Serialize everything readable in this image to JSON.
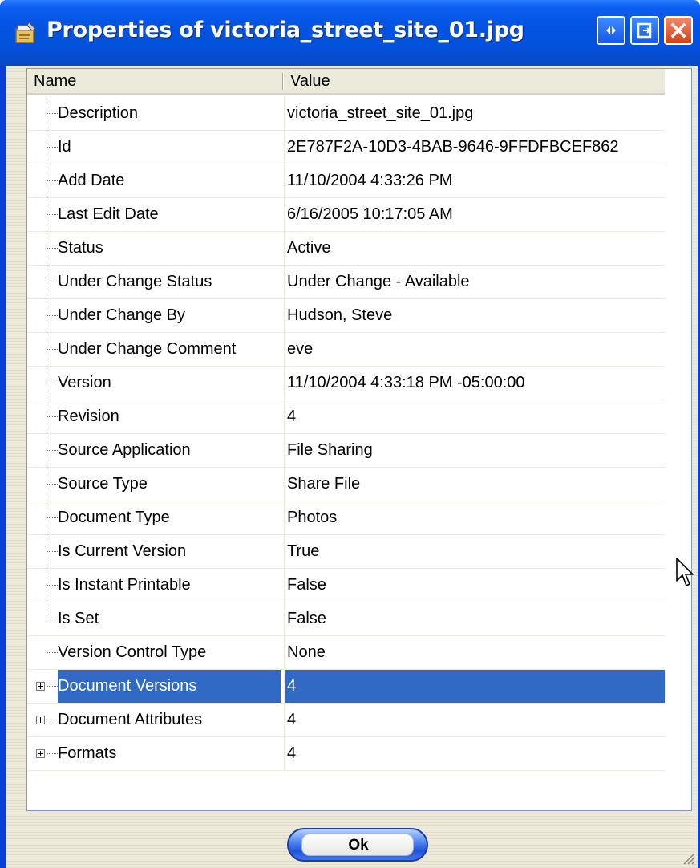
{
  "window": {
    "title": "Properties of victoria_street_site_01.jpg",
    "icons": {
      "app": "properties-icon",
      "restore": "restore-arrows-icon",
      "maximize": "maximize-icon",
      "close": "close-icon"
    }
  },
  "grid": {
    "columns": {
      "name": "Name",
      "value": "Value"
    },
    "rows": [
      {
        "name": "Description",
        "value": "victoria_street_site_01.jpg"
      },
      {
        "name": "Id",
        "value": "2E787F2A-10D3-4BAB-9646-9FFDFBCEF862"
      },
      {
        "name": "Add Date",
        "value": "11/10/2004 4:33:26 PM"
      },
      {
        "name": "Last Edit Date",
        "value": "6/16/2005 10:17:05 AM"
      },
      {
        "name": "Status",
        "value": "Active"
      },
      {
        "name": "Under Change Status",
        "value": "Under Change - Available"
      },
      {
        "name": "Under Change By",
        "value": "Hudson, Steve"
      },
      {
        "name": "Under Change Comment",
        "value": "eve"
      },
      {
        "name": "Version",
        "value": "11/10/2004 4:33:18 PM -05:00:00"
      },
      {
        "name": "Revision",
        "value": "4"
      },
      {
        "name": "Source Application",
        "value": "File Sharing"
      },
      {
        "name": "Source Type",
        "value": "Share File"
      },
      {
        "name": "Document Type",
        "value": "Photos"
      },
      {
        "name": "Is Current Version",
        "value": "True"
      },
      {
        "name": "Is Instant Printable",
        "value": "False"
      },
      {
        "name": "Is Set",
        "value": "False"
      },
      {
        "name": "Version Control Type",
        "value": "None"
      },
      {
        "name": "Document Versions",
        "value": "4",
        "expandable": true,
        "selected": true
      },
      {
        "name": "Document Attributes",
        "value": "4",
        "expandable": true
      },
      {
        "name": "Formats",
        "value": "4",
        "expandable": true
      }
    ]
  },
  "footer": {
    "ok_label": "Ok"
  },
  "colors": {
    "titlebar": "#0453e2",
    "selection": "#316ac5",
    "client": "#ece9d8"
  }
}
